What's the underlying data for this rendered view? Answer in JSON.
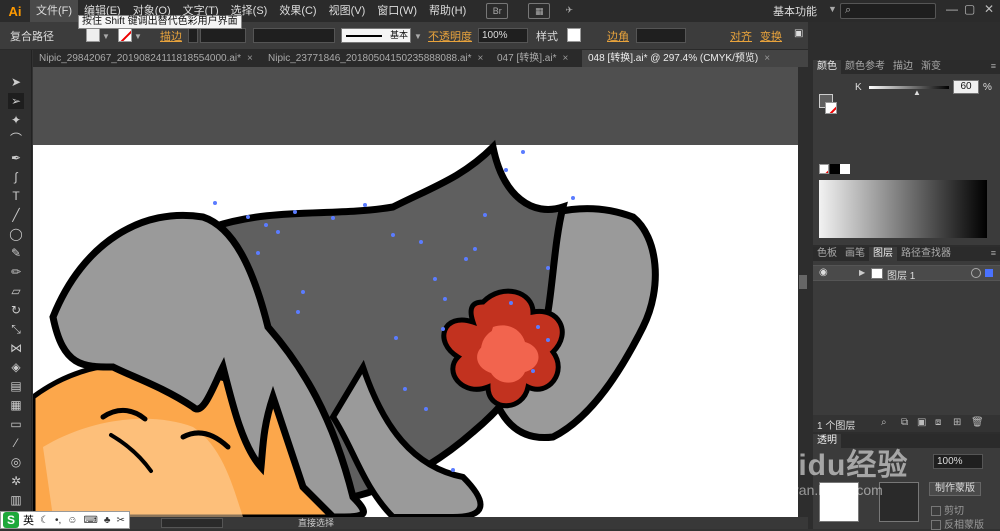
{
  "app": {
    "logo": "Ai"
  },
  "menu": {
    "items": [
      "文件(F)",
      "编辑(E)",
      "对象(O)",
      "文字(T)",
      "选择(S)",
      "效果(C)",
      "视图(V)",
      "窗口(W)",
      "帮助(H)"
    ],
    "bridge_icon": "Br",
    "workspace": "基本功能",
    "search_placeholder": ""
  },
  "tooltip": "按住 Shift 键调出替代色彩用户界面",
  "control_bar": {
    "selection_type": "复合路径",
    "stroke_link": "描边",
    "stroke_style": "基本",
    "opacity_link": "不透明度",
    "opacity_value": "100%",
    "style_label": "样式",
    "corner_link": "边角",
    "align_link": "对齐",
    "transform_link": "变换"
  },
  "tabs": [
    {
      "label": "Nipic_29842067_20190824111818554000.ai*"
    },
    {
      "label": "Nipic_23771846_20180504150235888088.ai*"
    },
    {
      "label": "047 [转换].ai*"
    },
    {
      "label": "048 [转换].ai* @ 297.4% (CMYK/预览)"
    }
  ],
  "status_bar": {
    "zoom": "",
    "mode": "直接选择"
  },
  "ime": {
    "lang": "英"
  },
  "color_panel": {
    "tabs": [
      "颜色",
      "颜色参考",
      "描边",
      "渐变"
    ],
    "channel_label": "K",
    "channel_value": "60",
    "percent": "%"
  },
  "layers_panel": {
    "tabs": [
      "色板",
      "画笔",
      "图层",
      "路径查找器"
    ],
    "layer_name": "图层 1",
    "layer_count": "1 个图层"
  },
  "transparency_panel": {
    "tab": "透明",
    "opacity_value": "100%",
    "make_mask_button": "制作蒙版",
    "clip_label": "剪切",
    "invert_mask_label": "反相蒙版"
  },
  "watermark": {
    "brand": "Baidu经验",
    "url": "jingyan.baidu.com"
  },
  "colors": {
    "hair_dark": "#5f5f5f",
    "hair_light": "#9a9a9a",
    "skin": "#fca74b",
    "flower_outer": "#c2321f",
    "flower_inner": "#f2644e",
    "accent": "#e8a33c",
    "anchor": "#5b7cff"
  }
}
